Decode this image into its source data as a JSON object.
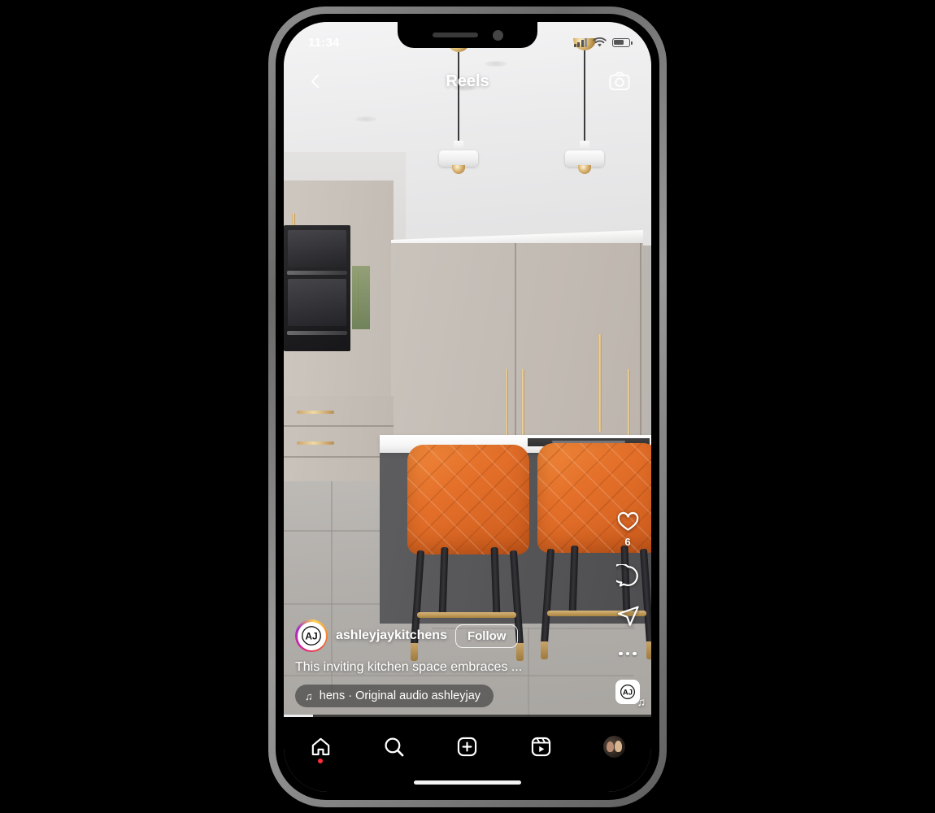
{
  "status_bar": {
    "time": "11:34",
    "signal_icon": "signal-bars-icon",
    "wifi_icon": "wifi-icon",
    "battery_icon": "battery-icon"
  },
  "header": {
    "back_icon": "chevron-left-icon",
    "title": "Reels",
    "camera_icon": "camera-icon"
  },
  "reel": {
    "username": "ashleyjaykitchens",
    "follow_label": "Follow",
    "caption": "This inviting kitchen space embraces ...",
    "avatar_monogram": "AJ",
    "audio_ticker": "hens · Original audio    ashleyjay",
    "audio_note_icon": "music-note-icon",
    "progress_percent": 8
  },
  "actions": {
    "like": {
      "icon": "heart-icon",
      "count": "6"
    },
    "comment": {
      "icon": "comment-bubble-icon"
    },
    "share": {
      "icon": "paper-plane-icon"
    },
    "more": {
      "icon": "ellipsis-icon"
    },
    "audio_thumb": {
      "icon": "audio-thumbnail-icon",
      "monogram": "AJ",
      "badge_icon": "music-note-icon"
    }
  },
  "tab_bar": {
    "items": [
      {
        "name": "home",
        "icon": "home-icon",
        "has_badge": true
      },
      {
        "name": "search",
        "icon": "search-icon",
        "has_badge": false
      },
      {
        "name": "create",
        "icon": "plus-square-icon",
        "has_badge": false
      },
      {
        "name": "reels",
        "icon": "reels-icon",
        "has_badge": false
      },
      {
        "name": "profile",
        "icon": "profile-avatar-icon",
        "has_badge": false
      }
    ]
  },
  "colors": {
    "accent_orange": "#e4702a",
    "notification_red": "#ff2d3a",
    "cabinet_taupe": "#c4bdb6",
    "island_gray": "#545456"
  }
}
